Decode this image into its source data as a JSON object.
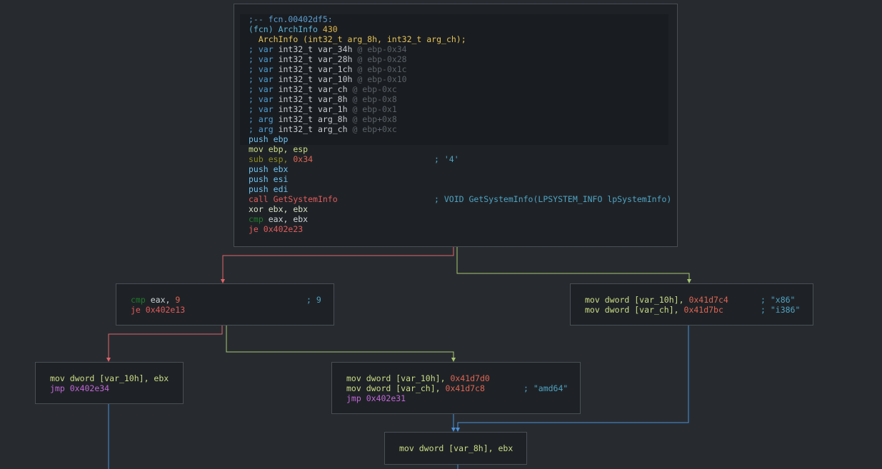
{
  "colors": {
    "background": "#272b30",
    "node_bg": "#1e2226",
    "node_border": "#4a4f55",
    "edge_false": "#e06468",
    "edge_true": "#a8c76e",
    "edge_jump": "#4a90d9"
  },
  "nodes": {
    "main": {
      "header_label": ";-- fcn.00402df5:",
      "fcn_prefix": "(fcn)",
      "fcn_name": "ArchInfo",
      "fcn_size": "430",
      "signature": "ArchInfo (int32_t arg_8h, int32_t arg_ch);",
      "vars": [
        {
          "kind": "; var",
          "type": "int32_t",
          "name": "var_34h",
          "loc": "@ ebp-0x34"
        },
        {
          "kind": "; var",
          "type": "int32_t",
          "name": "var_28h",
          "loc": "@ ebp-0x28"
        },
        {
          "kind": "; var",
          "type": "int32_t",
          "name": "var_1ch",
          "loc": "@ ebp-0x1c"
        },
        {
          "kind": "; var",
          "type": "int32_t",
          "name": "var_10h",
          "loc": "@ ebp-0x10"
        },
        {
          "kind": "; var",
          "type": "int32_t",
          "name": "var_ch",
          "loc": "@ ebp-0xc"
        },
        {
          "kind": "; var",
          "type": "int32_t",
          "name": "var_8h",
          "loc": "@ ebp-0x8"
        },
        {
          "kind": "; var",
          "type": "int32_t",
          "name": "var_1h",
          "loc": "@ ebp-0x1"
        },
        {
          "kind": "; arg",
          "type": "int32_t",
          "name": "arg_8h",
          "loc": "@ ebp+0x8"
        },
        {
          "kind": "; arg",
          "type": "int32_t",
          "name": "arg_ch",
          "loc": "@ ebp+0xc"
        }
      ],
      "instructions": {
        "i1_mn": "push",
        "i1_op": "ebp",
        "i2_mn": "mov",
        "i2_op": "ebp, esp",
        "i3_mn": "sub",
        "i3_op": "esp,",
        "i3_hex": "0x34",
        "i3_cmt": "; '4'",
        "i4_mn": "push",
        "i4_op": "ebx",
        "i5_mn": "push",
        "i5_op": "esi",
        "i6_mn": "push",
        "i6_op": "edi",
        "i7_mn": "call",
        "i7_op": "GetSystemInfo",
        "i7_cmt": "; VOID GetSystemInfo(LPSYSTEM_INFO lpSystemInfo)",
        "i8_mn": "xor",
        "i8_op": "ebx, ebx",
        "i9_mn": "cmp",
        "i9_op": "eax, ebx",
        "i10_mn": "je",
        "i10_op": "0x402e23"
      }
    },
    "cmp9": {
      "l1_mn": "cmp",
      "l1_op": "eax,",
      "l1_num": "9",
      "l1_cmt": "; 9",
      "l2_mn": "je",
      "l2_op": "0x402e13"
    },
    "x86": {
      "l1_mn": "mov",
      "l1_op": "dword [var_10h],",
      "l1_hex": "0x41d7c4",
      "l1_cmt": "; \"x86\"",
      "l2_mn": "mov",
      "l2_op": "dword [var_ch],",
      "l2_hex": "0x41d7bc",
      "l2_cmt": "; \"i386\""
    },
    "mov_ebx": {
      "l1_mn": "mov",
      "l1_op": "dword [var_10h], ebx",
      "l2_mn": "jmp",
      "l2_op": "0x402e34"
    },
    "amd64": {
      "l1_mn": "mov",
      "l1_op": "dword [var_10h],",
      "l1_hex": "0x41d7d0",
      "l2_mn": "mov",
      "l2_op": "dword [var_ch],",
      "l2_hex": "0x41d7c8",
      "l2_cmt": "; \"amd64\"",
      "l3_mn": "jmp",
      "l3_op": "0x402e31"
    },
    "var8h": {
      "l1_mn": "mov",
      "l1_op": "dword [var_8h], ebx"
    }
  }
}
